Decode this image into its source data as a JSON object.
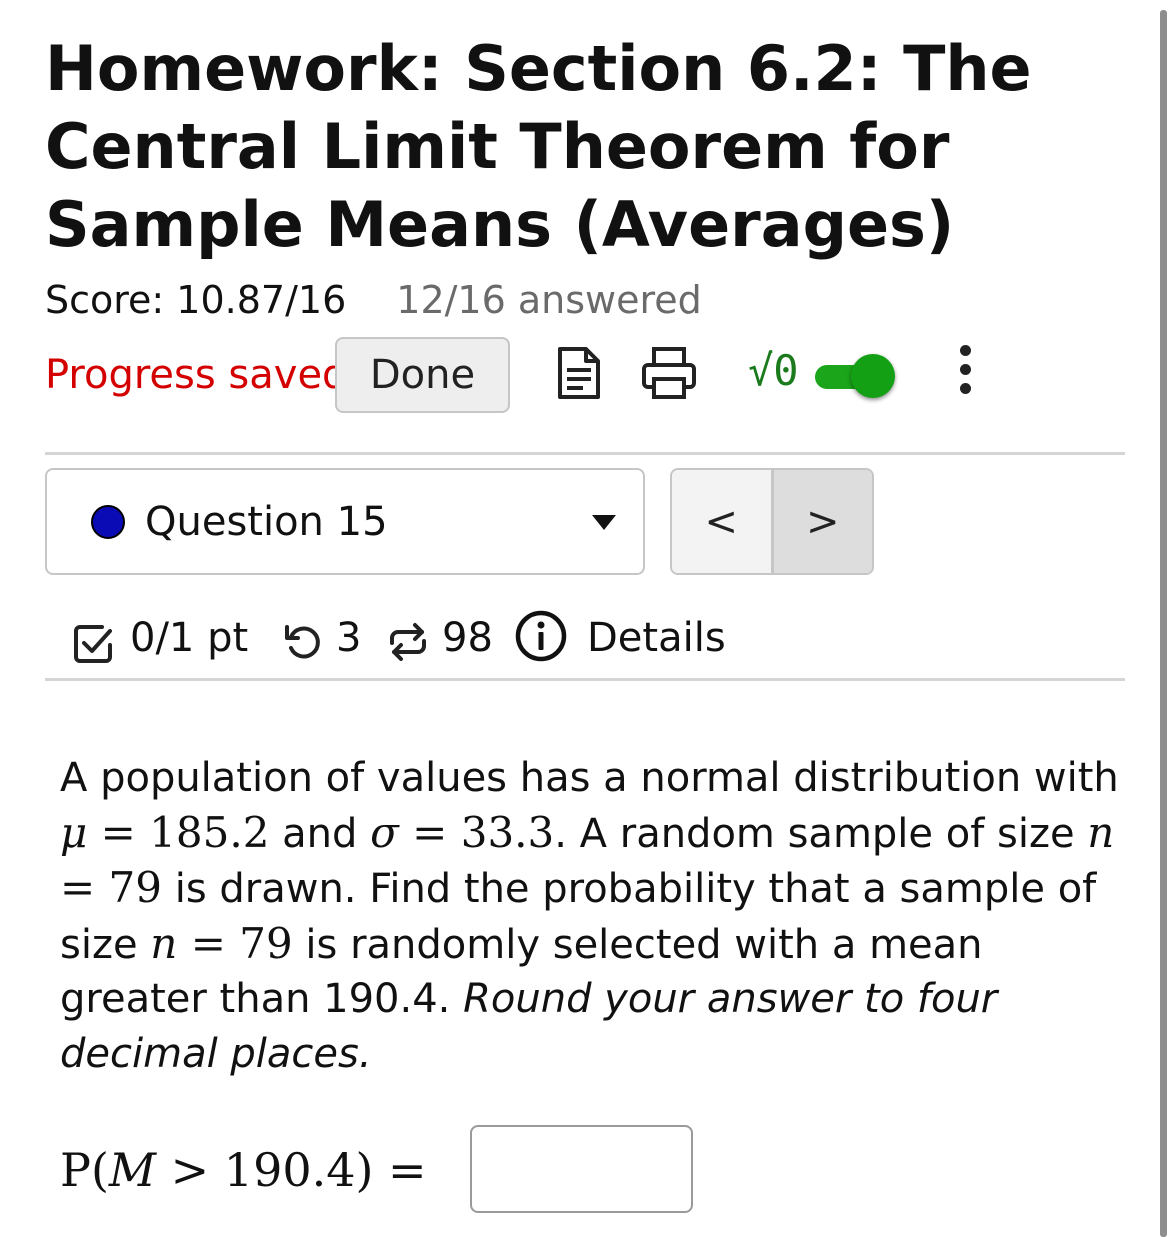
{
  "page": {
    "title": "Homework: Section 6.2: The Central Limit Theorem for Sample Means (Averages)"
  },
  "score": {
    "text": "Score: 10.87/16",
    "answered": "12/16 answered"
  },
  "toolbar": {
    "progress_saved": "Progress saved",
    "done_label": "Done",
    "icons": [
      "document-icon",
      "print-icon",
      "math-input-icon",
      "toggle-switch",
      "more-menu-icon"
    ],
    "math_icon_text": "√0",
    "toggle_state": "on",
    "accent_color": "#1aa51a"
  },
  "question_nav": {
    "selected_label": "Question 15",
    "status_dot_color": "#0b0bb5",
    "prev_label": "<",
    "next_label": ">"
  },
  "meta": {
    "points": "0/1 pt",
    "retries": "3",
    "attempts": "98",
    "details_label": "Details"
  },
  "problem": {
    "t1": "A population of values has a normal distribution with ",
    "mu_sym": "μ",
    "mu_val": "185.2",
    "t2": " and ",
    "sigma_sym": "σ",
    "sigma_val": "33.3",
    "t3": ". A random sample of size ",
    "n_sym": "n",
    "n_val": "79",
    "t4": " is drawn. Find the probability that a sample of size ",
    "t5": " is randomly selected with a mean greater than 190.4. ",
    "instruction": "Round your answer to four decimal places."
  },
  "answer": {
    "label_prefix": "P(",
    "label_var": "M",
    "label_suffix": " > 190.4) =",
    "value": ""
  }
}
